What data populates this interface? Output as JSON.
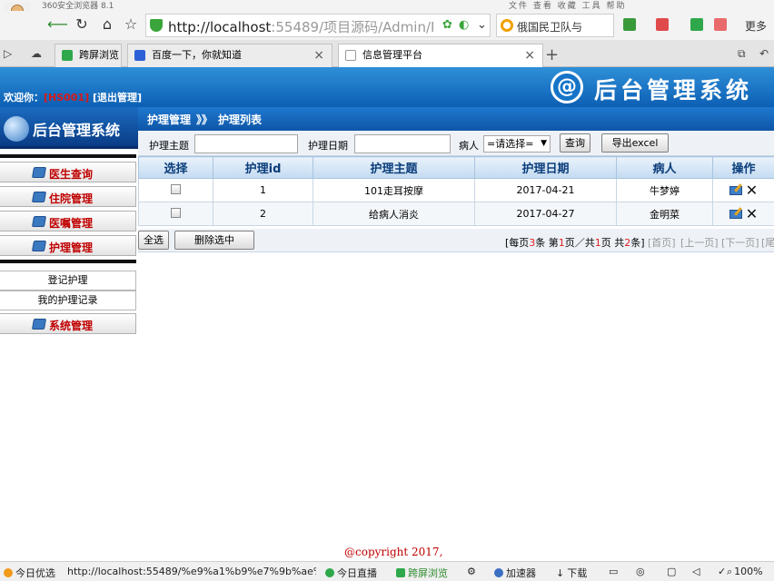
{
  "browser": {
    "window_title": "360安全浏览器 8.1",
    "title_menu": "文件  查看  收藏  工具  帮助",
    "url_host": "http://localhost",
    "url_rest": ":55489/项目源码/Admin/NurseI",
    "search_text": "俄国民卫队与",
    "more_label": "更多",
    "tabs": [
      {
        "label": "跨屏浏览"
      },
      {
        "label": "百度一下，你就知道"
      },
      {
        "label": "信息管理平台"
      }
    ]
  },
  "header": {
    "welcome_prefix": "欢迎你：",
    "user_id": "[HS001]",
    "logout_label": "[退出管理]",
    "brand_logo": "@",
    "brand_title": "后台管理系统"
  },
  "sidebar": {
    "logo_title": "后台管理系统",
    "menu": [
      {
        "label": "医生查询"
      },
      {
        "label": "住院管理"
      },
      {
        "label": "医嘱管理"
      },
      {
        "label": "护理管理"
      }
    ],
    "submenu": [
      {
        "label": "登记护理"
      },
      {
        "label": "我的护理记录"
      }
    ],
    "system_label": "系统管理"
  },
  "breadcrumb": {
    "section": "护理管理",
    "separator": "》》",
    "page": "护理列表"
  },
  "filter": {
    "topic_label": "护理主题",
    "date_label": "护理日期",
    "patient_label": "病人",
    "patient_selected": "=请选择=",
    "query_label": "查询",
    "export_label": "导出excel"
  },
  "table": {
    "headers": [
      "选择",
      "护理id",
      "护理主题",
      "护理日期",
      "病人",
      "操作"
    ],
    "rows": [
      {
        "id": "1",
        "topic": "101走耳按摩",
        "date": "2017-04-21",
        "patient": "牛梦婷"
      },
      {
        "id": "2",
        "topic": "给病人消炎",
        "date": "2017-04-27",
        "patient": "金明菜"
      }
    ]
  },
  "pager": {
    "select_all": "全选",
    "delete_selected": "删除选中",
    "info_prefix": "[每页",
    "per_page": "3",
    "info_mid1": "条 第",
    "current_page": "1",
    "info_mid2": "页／共",
    "total_pages": "1",
    "info_mid3": "页 共",
    "total_items": "2",
    "info_suffix": "条]",
    "first": "[首页]",
    "prev": "[上一页]",
    "next": "[下一页]",
    "last": "[尾"
  },
  "footer": {
    "copyright": "@copyright 2017,"
  },
  "statusbar": {
    "today_label": "今日优选",
    "status_url": "http://localhost:55489/%e9%a1%b9%e7%9b%ae%e",
    "live_label": "今日直播",
    "cross_label": "跨屏浏览",
    "speed_label": "加速器",
    "download_label": "下载",
    "zoom": "100%"
  },
  "colors": {
    "header_blue": "#0c5fb4",
    "menu_red": "#c00000",
    "count_red": "#e02020"
  }
}
